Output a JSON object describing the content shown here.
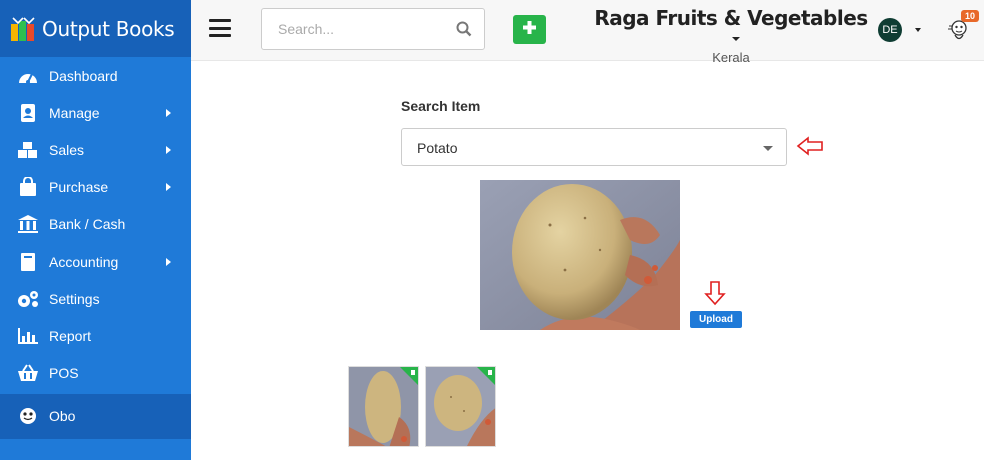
{
  "brand": {
    "name": "Output Books"
  },
  "sidebar": {
    "items": [
      {
        "label": "Dashboard",
        "icon": "dashboard-icon",
        "submenu": false
      },
      {
        "label": "Manage",
        "icon": "manage-icon",
        "submenu": true
      },
      {
        "label": "Sales",
        "icon": "sales-icon",
        "submenu": true
      },
      {
        "label": "Purchase",
        "icon": "purchase-icon",
        "submenu": true
      },
      {
        "label": "Bank / Cash",
        "icon": "bank-icon",
        "submenu": false
      },
      {
        "label": "Accounting",
        "icon": "accounting-icon",
        "submenu": true
      },
      {
        "label": "Settings",
        "icon": "settings-icon",
        "submenu": false
      },
      {
        "label": "Report",
        "icon": "report-icon",
        "submenu": false
      },
      {
        "label": "POS",
        "icon": "pos-icon",
        "submenu": false
      },
      {
        "label": "Obo",
        "icon": "obo-icon",
        "submenu": false
      }
    ]
  },
  "header": {
    "search_placeholder": "Search...",
    "company_name": "Raga Fruits & Vegetables",
    "company_location": "Kerala",
    "avatar_initials": "DE",
    "notification_count": "10"
  },
  "main": {
    "search_label": "Search Item",
    "selected_item": "Potato",
    "upload_label": "Upload"
  },
  "colors": {
    "sidebar": "#1f7ad8",
    "sidebar_dark": "#1761b8",
    "add_button": "#28b44a",
    "badge": "#e8692a",
    "annotation_arrow": "#e02020"
  }
}
